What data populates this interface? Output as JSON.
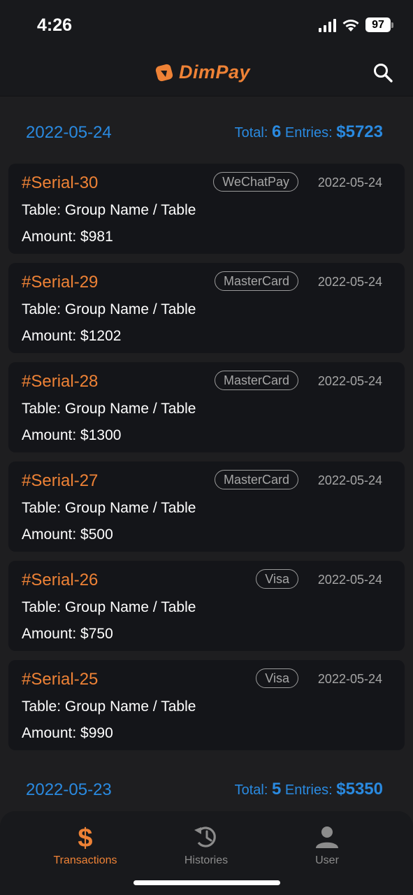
{
  "status_bar": {
    "time": "4:26",
    "battery": "97",
    "icons": [
      "signal-icon",
      "wifi-icon",
      "battery-icon"
    ]
  },
  "header": {
    "logo_text": "DimPay",
    "search_icon": "search-icon"
  },
  "colors": {
    "accent": "#ee8236",
    "link_blue": "#2a8ae0",
    "background": "#1e1e20",
    "card": "#141519"
  },
  "days": [
    {
      "date": "2022-05-24",
      "total_label": "Total:",
      "count": "6",
      "entries_label": "Entries:",
      "amount": "$5723",
      "transactions": [
        {
          "serial": "#Serial-30",
          "method": "WeChatPay",
          "date": "2022-05-24",
          "table": "Table: Group Name / Table",
          "amount": "Amount: $981"
        },
        {
          "serial": "#Serial-29",
          "method": "MasterCard",
          "date": "2022-05-24",
          "table": "Table: Group Name / Table",
          "amount": "Amount: $1202"
        },
        {
          "serial": "#Serial-28",
          "method": "MasterCard",
          "date": "2022-05-24",
          "table": "Table: Group Name / Table",
          "amount": "Amount: $1300"
        },
        {
          "serial": "#Serial-27",
          "method": "MasterCard",
          "date": "2022-05-24",
          "table": "Table: Group Name / Table",
          "amount": "Amount: $500"
        },
        {
          "serial": "#Serial-26",
          "method": "Visa",
          "date": "2022-05-24",
          "table": "Table: Group Name / Table",
          "amount": "Amount: $750"
        },
        {
          "serial": "#Serial-25",
          "method": "Visa",
          "date": "2022-05-24",
          "table": "Table: Group Name / Table",
          "amount": "Amount: $990"
        }
      ]
    },
    {
      "date": "2022-05-23",
      "total_label": "Total:",
      "count": "5",
      "entries_label": "Entries:",
      "amount": "$5350"
    }
  ],
  "tabs": [
    {
      "label": "Transactions",
      "icon": "dollar-icon",
      "active": true
    },
    {
      "label": "Histories",
      "icon": "history-icon",
      "active": false
    },
    {
      "label": "User",
      "icon": "user-icon",
      "active": false
    }
  ]
}
